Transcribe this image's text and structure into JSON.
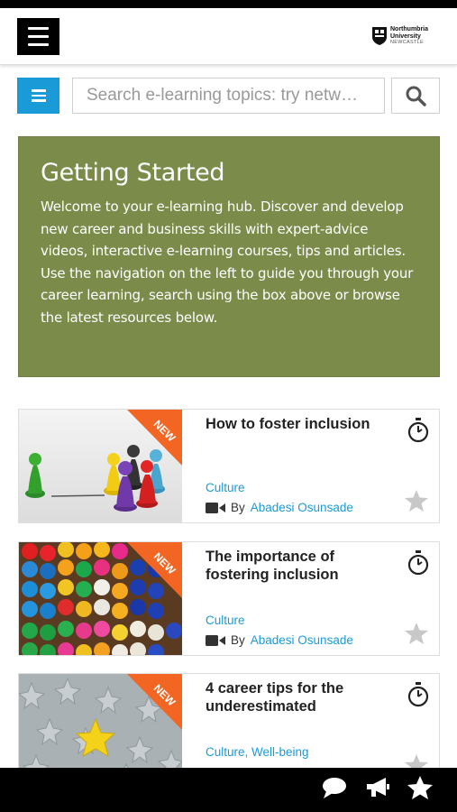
{
  "header": {
    "menu_icon": "hamburger-menu-icon",
    "logo": {
      "line1": "Northumbria",
      "line2": "University",
      "line3": "NEWCASTLE"
    }
  },
  "search": {
    "filter_icon": "list-menu-icon",
    "placeholder": "Search e-learning topics: try netw…",
    "button_icon": "search-icon"
  },
  "getting_started": {
    "title": "Getting Started",
    "body": "Welcome to your e-learning hub. Discover and develop new career and business skills with expert-advice videos, interactive e-learning courses, tips and articles. Use the navigation on the left to guide you through your career learning, search using the box above or browse the latest resources below."
  },
  "cards": [
    {
      "badge": "NEW",
      "title": "How to foster inclusion",
      "category": "Culture",
      "by": "By",
      "author": "Abadesi Osunsade",
      "has_video": true
    },
    {
      "badge": "NEW",
      "title": "The importance of fostering inclusion",
      "category": "Culture",
      "by": "By",
      "author": "Abadesi Osunsade",
      "has_video": true
    },
    {
      "badge": "NEW",
      "title": "4 career tips for the underestimated",
      "category": "Culture, Well-being"
    }
  ],
  "colors": {
    "accent_blue": "#1a9ad6",
    "panel_green": "#7b8b4a",
    "badge_orange": "#f26522"
  },
  "bottom_bar": {
    "icons": [
      "chat-bubble-icon",
      "megaphone-icon",
      "star-icon"
    ]
  }
}
